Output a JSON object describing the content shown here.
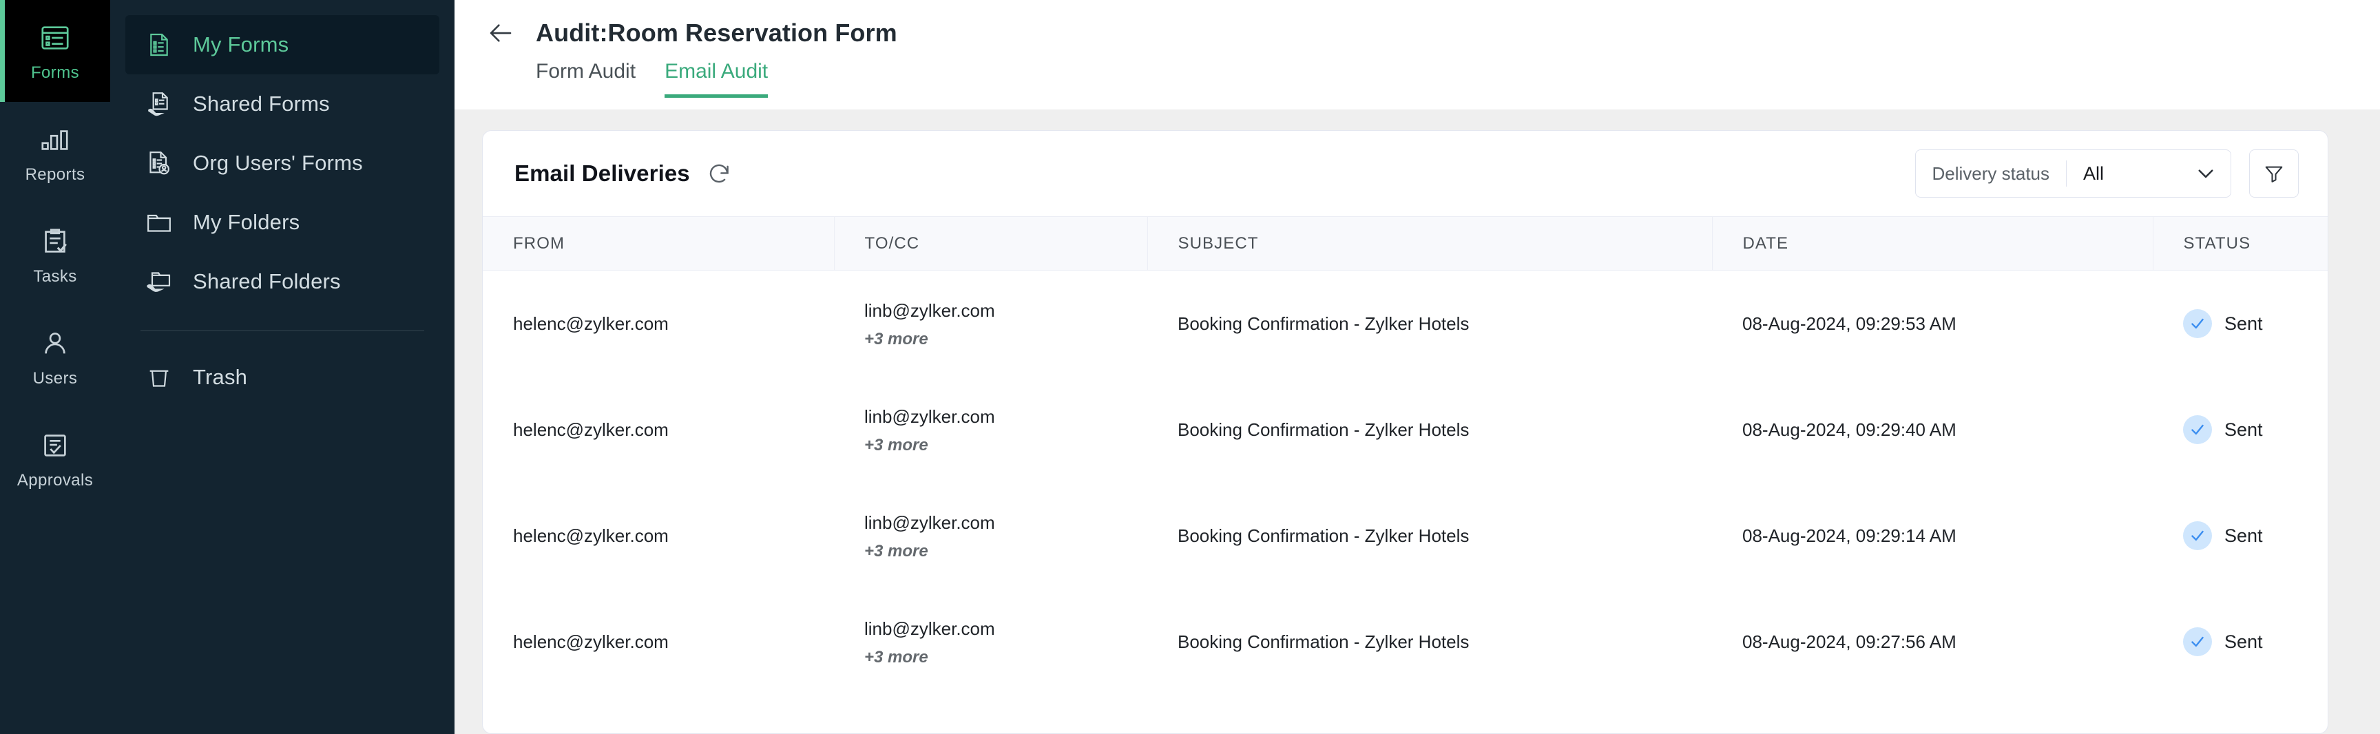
{
  "colors": {
    "rail_bg": "#132430",
    "rail_active_bg": "#000000",
    "accent_green": "#5dc99a",
    "tab_active": "#3aaa7c",
    "page_bg": "#efefef",
    "card_bg": "#ffffff",
    "status_icon_bg": "#cfe6fd",
    "status_icon_check": "#3b8ef0"
  },
  "icon_rail": {
    "items": [
      {
        "label": "Forms",
        "icon": "forms-icon",
        "active": true
      },
      {
        "label": "Reports",
        "icon": "reports-icon",
        "active": false
      },
      {
        "label": "Tasks",
        "icon": "tasks-icon",
        "active": false
      },
      {
        "label": "Users",
        "icon": "users-icon",
        "active": false
      },
      {
        "label": "Approvals",
        "icon": "approvals-icon",
        "active": false
      }
    ]
  },
  "sidebar": {
    "items": [
      {
        "label": "My Forms",
        "icon": "document-list-icon",
        "active": true
      },
      {
        "label": "Shared Forms",
        "icon": "shared-document-icon",
        "active": false
      },
      {
        "label": "Org Users' Forms",
        "icon": "document-user-icon",
        "active": false
      },
      {
        "label": "My Folders",
        "icon": "folder-icon",
        "active": false
      },
      {
        "label": "Shared Folders",
        "icon": "shared-folder-icon",
        "active": false
      }
    ],
    "trash": {
      "label": "Trash",
      "icon": "trash-icon"
    }
  },
  "header": {
    "back_icon": "back-arrow-icon",
    "title": "Audit:Room Reservation Form",
    "tabs": [
      {
        "label": "Form Audit",
        "active": false
      },
      {
        "label": "Email Audit",
        "active": true
      }
    ]
  },
  "card": {
    "title": "Email Deliveries",
    "refresh_icon": "refresh-icon",
    "filter": {
      "select_label": "Delivery status",
      "select_value": "All",
      "select_options": [
        "All"
      ],
      "caret_icon": "chevron-down-icon",
      "filter_icon": "funnel-icon"
    }
  },
  "table": {
    "columns": [
      "FROM",
      "TO/CC",
      "SUBJECT",
      "DATE",
      "STATUS"
    ],
    "rows": [
      {
        "from": "helenc@zylker.com",
        "to": "linb@zylker.com",
        "to_more": "+3 more",
        "subject": "Booking Confirmation - Zylker Hotels",
        "date": "08-Aug-2024, 09:29:53 AM",
        "status": "Sent",
        "status_icon": "check-circle-icon"
      },
      {
        "from": "helenc@zylker.com",
        "to": "linb@zylker.com",
        "to_more": "+3 more",
        "subject": "Booking Confirmation - Zylker Hotels",
        "date": "08-Aug-2024, 09:29:40 AM",
        "status": "Sent",
        "status_icon": "check-circle-icon"
      },
      {
        "from": "helenc@zylker.com",
        "to": "linb@zylker.com",
        "to_more": "+3 more",
        "subject": "Booking Confirmation - Zylker Hotels",
        "date": "08-Aug-2024, 09:29:14 AM",
        "status": "Sent",
        "status_icon": "check-circle-icon"
      },
      {
        "from": "helenc@zylker.com",
        "to": "linb@zylker.com",
        "to_more": "+3 more",
        "subject": "Booking Confirmation - Zylker Hotels",
        "date": "08-Aug-2024, 09:27:56 AM",
        "status": "Sent",
        "status_icon": "check-circle-icon"
      }
    ]
  }
}
